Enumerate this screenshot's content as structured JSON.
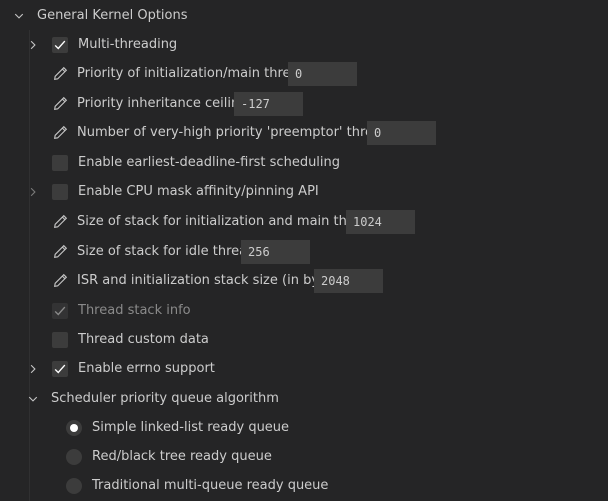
{
  "section": {
    "title": "General Kernel Options",
    "expanded": true
  },
  "options": [
    {
      "kind": "checkbox",
      "label": "Multi-threading",
      "checked": true,
      "expandable": true,
      "expanded": false
    },
    {
      "kind": "field",
      "label": "Priority of initialization/main thread",
      "value": "0"
    },
    {
      "kind": "field",
      "label": "Priority inheritance ceiling",
      "value": "-127"
    },
    {
      "kind": "field",
      "label": "Number of very-high priority 'preemptor' threads",
      "value": "0"
    },
    {
      "kind": "checkbox",
      "label": "Enable earliest-deadline-first scheduling",
      "checked": false
    },
    {
      "kind": "checkbox",
      "label": "Enable CPU mask affinity/pinning API",
      "checked": false,
      "expandable": true,
      "expanded": false
    },
    {
      "kind": "field",
      "label": "Size of stack for initialization and main thread",
      "value": "1024"
    },
    {
      "kind": "field",
      "label": "Size of stack for idle thread",
      "value": "256"
    },
    {
      "kind": "field",
      "label": "ISR and initialization stack size (in bytes)",
      "value": "2048"
    },
    {
      "kind": "checkbox",
      "label": "Thread stack info",
      "checked": true,
      "disabled": true
    },
    {
      "kind": "checkbox",
      "label": "Thread custom data",
      "checked": false
    },
    {
      "kind": "checkbox",
      "label": "Enable errno support",
      "checked": true,
      "expandable": true,
      "expanded": false
    }
  ],
  "scheduler": {
    "title": "Scheduler priority queue algorithm",
    "expanded": true,
    "choices": [
      {
        "label": "Simple linked-list ready queue",
        "selected": true
      },
      {
        "label": "Red/black tree ready queue",
        "selected": false
      },
      {
        "label": "Traditional multi-queue ready queue",
        "selected": false
      }
    ]
  },
  "icons": {
    "chevron_down": "chevron-down-icon",
    "chevron_right": "chevron-right-icon",
    "edit": "pencil-icon",
    "check": "check-icon"
  },
  "colors": {
    "background": "#252526",
    "control": "#3c3c3c",
    "text": "#cccccc",
    "disabled_text": "#8a8a8a"
  }
}
